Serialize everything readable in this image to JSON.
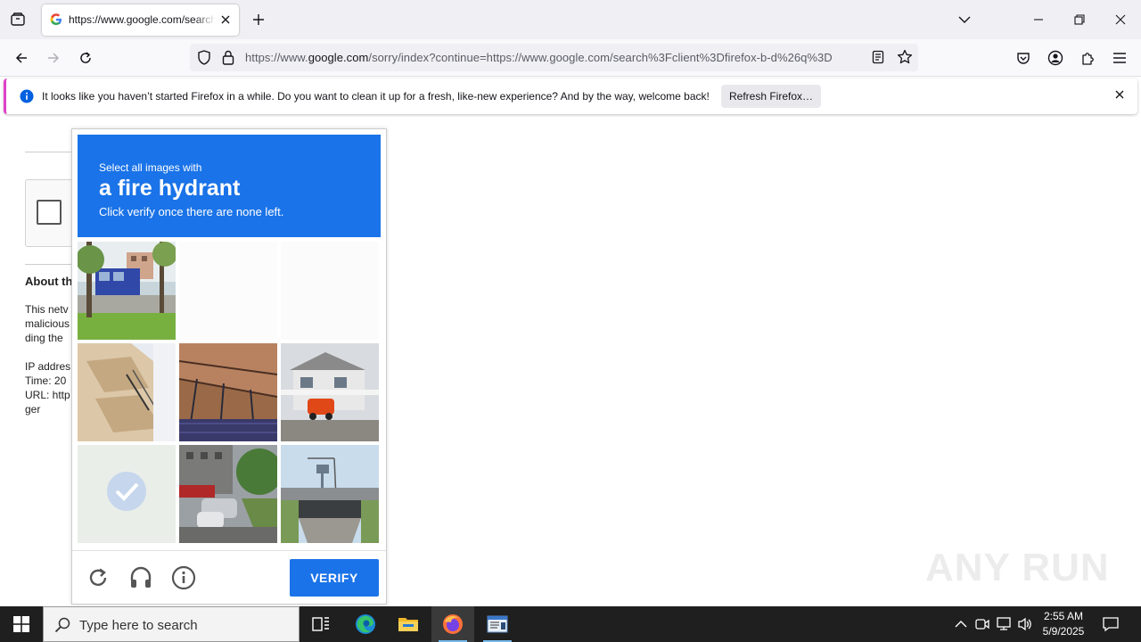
{
  "browser": {
    "tab": {
      "title": "https://www.google.com/search?client=firefox-b-d&q"
    },
    "url": {
      "scheme": "https://www.",
      "host": "google.com",
      "rest": "/sorry/index?continue=https://www.google.com/search%3Fclient%3Dfirefox-b-d%26q%3D"
    }
  },
  "notification": {
    "message": "It looks like you haven’t started Firefox in a while. Do you want to clean it up for a fresh, like-new experience? And by the way, welcome back!",
    "button_label": "Refresh Firefox…"
  },
  "page": {
    "about_title": "About th",
    "about_lines": [
      "This netv",
      "malicious",
      "ding the",
      "",
      "IP addres",
      "Time: 20",
      "URL: http",
      "ger"
    ]
  },
  "captcha": {
    "line1": "Select all images with",
    "line2": "a fire hydrant",
    "line3": "Click verify once there are none left.",
    "verify_label": "VERIFY",
    "brand_color": "#1a73e8",
    "tiles": [
      {
        "content": "street-bus",
        "state": "normal"
      },
      {
        "content": "",
        "state": "loading"
      },
      {
        "content": "",
        "state": "loading"
      },
      {
        "content": "building-balconies",
        "state": "normal"
      },
      {
        "content": "ceiling-pipes",
        "state": "normal"
      },
      {
        "content": "house-red-car",
        "state": "normal"
      },
      {
        "content": "",
        "state": "selected-fading"
      },
      {
        "content": "street-parked-cars",
        "state": "normal"
      },
      {
        "content": "overpass-water-tower",
        "state": "normal"
      }
    ]
  },
  "watermark": "ANY RUN",
  "taskbar": {
    "search_placeholder": "Type here to search",
    "time": "2:55 AM",
    "date": "5/9/2025"
  }
}
